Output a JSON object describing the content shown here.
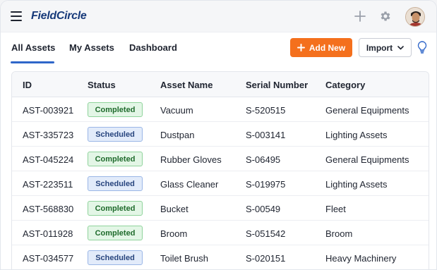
{
  "app": {
    "logo": "FieldCircle"
  },
  "nav": {
    "tabs": [
      {
        "label": "All Assets",
        "active": true
      },
      {
        "label": "My Assets"
      },
      {
        "label": "Dashboard"
      }
    ],
    "add_label": "Add New",
    "import_label": "Import"
  },
  "icons": {
    "menu": "hamburger-icon",
    "plus": "plus-icon",
    "settings": "gear-icon",
    "avatar": "user-avatar",
    "add": "plus-icon",
    "import_caret": "chevron-down-icon",
    "tips": "lightbulb-icon"
  },
  "colors": {
    "accent": "#f4701d",
    "brand": "#173a7a",
    "active_tab": "#2f66c9"
  },
  "table": {
    "columns": [
      "ID",
      "Status",
      "Asset Name",
      "Serial Number",
      "Category"
    ],
    "rows": [
      {
        "id": "AST-003921",
        "status": "Completed",
        "name": "Vacuum",
        "serial": "S-520515",
        "category": "General Equipments"
      },
      {
        "id": "AST-335723",
        "status": "Scheduled",
        "name": "Dustpan",
        "serial": "S-003141",
        "category": "Lighting Assets"
      },
      {
        "id": "AST-045224",
        "status": "Completed",
        "name": "Rubber Gloves",
        "serial": "S-06495",
        "category": "General Equipments"
      },
      {
        "id": "AST-223511",
        "status": "Scheduled",
        "name": "Glass Cleaner",
        "serial": "S-019975",
        "category": "Lighting Assets"
      },
      {
        "id": "AST-568830",
        "status": "Completed",
        "name": "Bucket",
        "serial": "S-00549",
        "category": "Fleet"
      },
      {
        "id": "AST-011928",
        "status": "Completed",
        "name": "Broom",
        "serial": "S-051542",
        "category": "Broom"
      },
      {
        "id": "AST-034577",
        "status": "Scheduled",
        "name": "Toilet Brush",
        "serial": "S-020151",
        "category": "Heavy Machinery"
      }
    ]
  }
}
